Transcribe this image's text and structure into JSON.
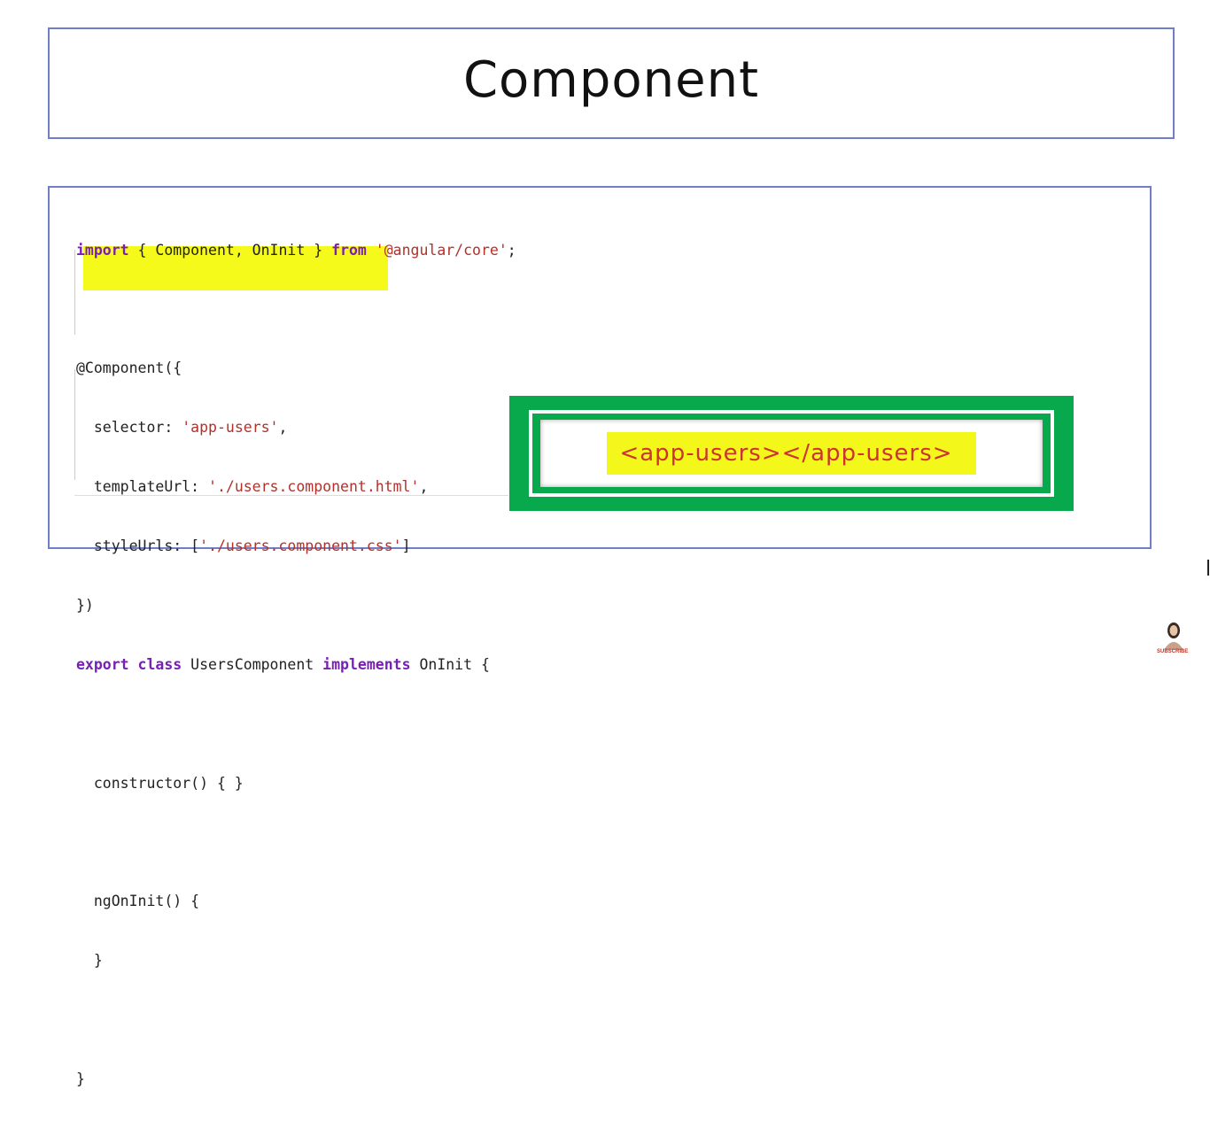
{
  "slide": {
    "title": "Component"
  },
  "code": {
    "lines": [
      "import { Component, OnInit } from '@angular/core';",
      "",
      "@Component({",
      "  selector: 'app-users',",
      "  templateUrl: './users.component.html',",
      "  styleUrls: ['./users.component.css']",
      "})",
      "export class UsersComponent implements OnInit {",
      "",
      "  constructor() { }",
      "",
      "  ngOnInit() {",
      "  }",
      "",
      "}"
    ]
  },
  "callout": {
    "tag": "<app-users></app-users>"
  },
  "branding": {
    "subscribe_text": "SUBSCRIBE"
  },
  "colors": {
    "keyword": "#7a1fb5",
    "string": "#b3312b",
    "highlight": "#f5fa1a",
    "callout_green": "#08a84d",
    "border_blue": "#6f7fc7"
  }
}
